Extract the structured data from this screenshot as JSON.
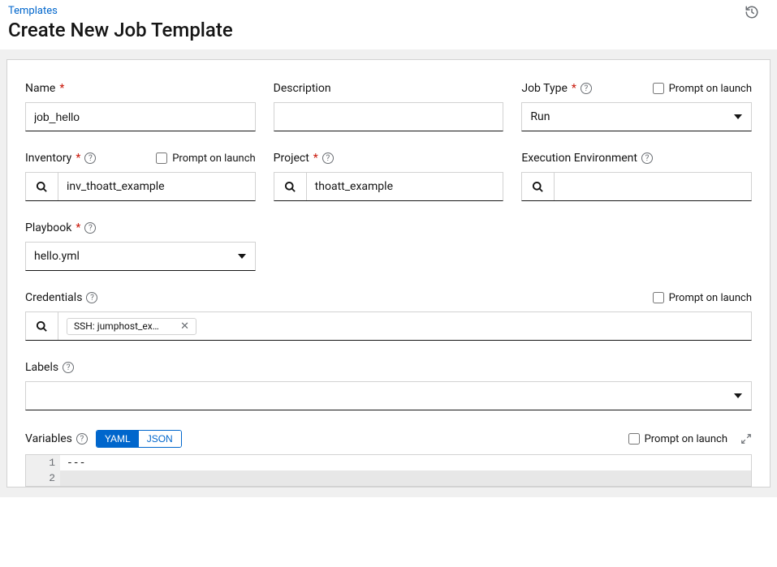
{
  "breadcrumb": "Templates",
  "page_title": "Create New Job Template",
  "fields": {
    "name": {
      "label": "Name",
      "value": "job_hello"
    },
    "description": {
      "label": "Description",
      "value": ""
    },
    "job_type": {
      "label": "Job Type",
      "selected": "Run",
      "prompt_label": "Prompt on launch"
    },
    "inventory": {
      "label": "Inventory",
      "value": "inv_thoatt_example",
      "prompt_label": "Prompt on launch"
    },
    "project": {
      "label": "Project",
      "value": "thoatt_example"
    },
    "exec_env": {
      "label": "Execution Environment",
      "value": ""
    },
    "playbook": {
      "label": "Playbook",
      "selected": "hello.yml"
    },
    "credentials": {
      "label": "Credentials",
      "chip": "SSH: jumphost_exam...",
      "prompt_label": "Prompt on launch"
    },
    "labels": {
      "label": "Labels"
    },
    "variables": {
      "label": "Variables",
      "yaml_btn": "YAML",
      "json_btn": "JSON",
      "prompt_label": "Prompt on launch",
      "lines": {
        "1": "---",
        "2": ""
      }
    }
  }
}
